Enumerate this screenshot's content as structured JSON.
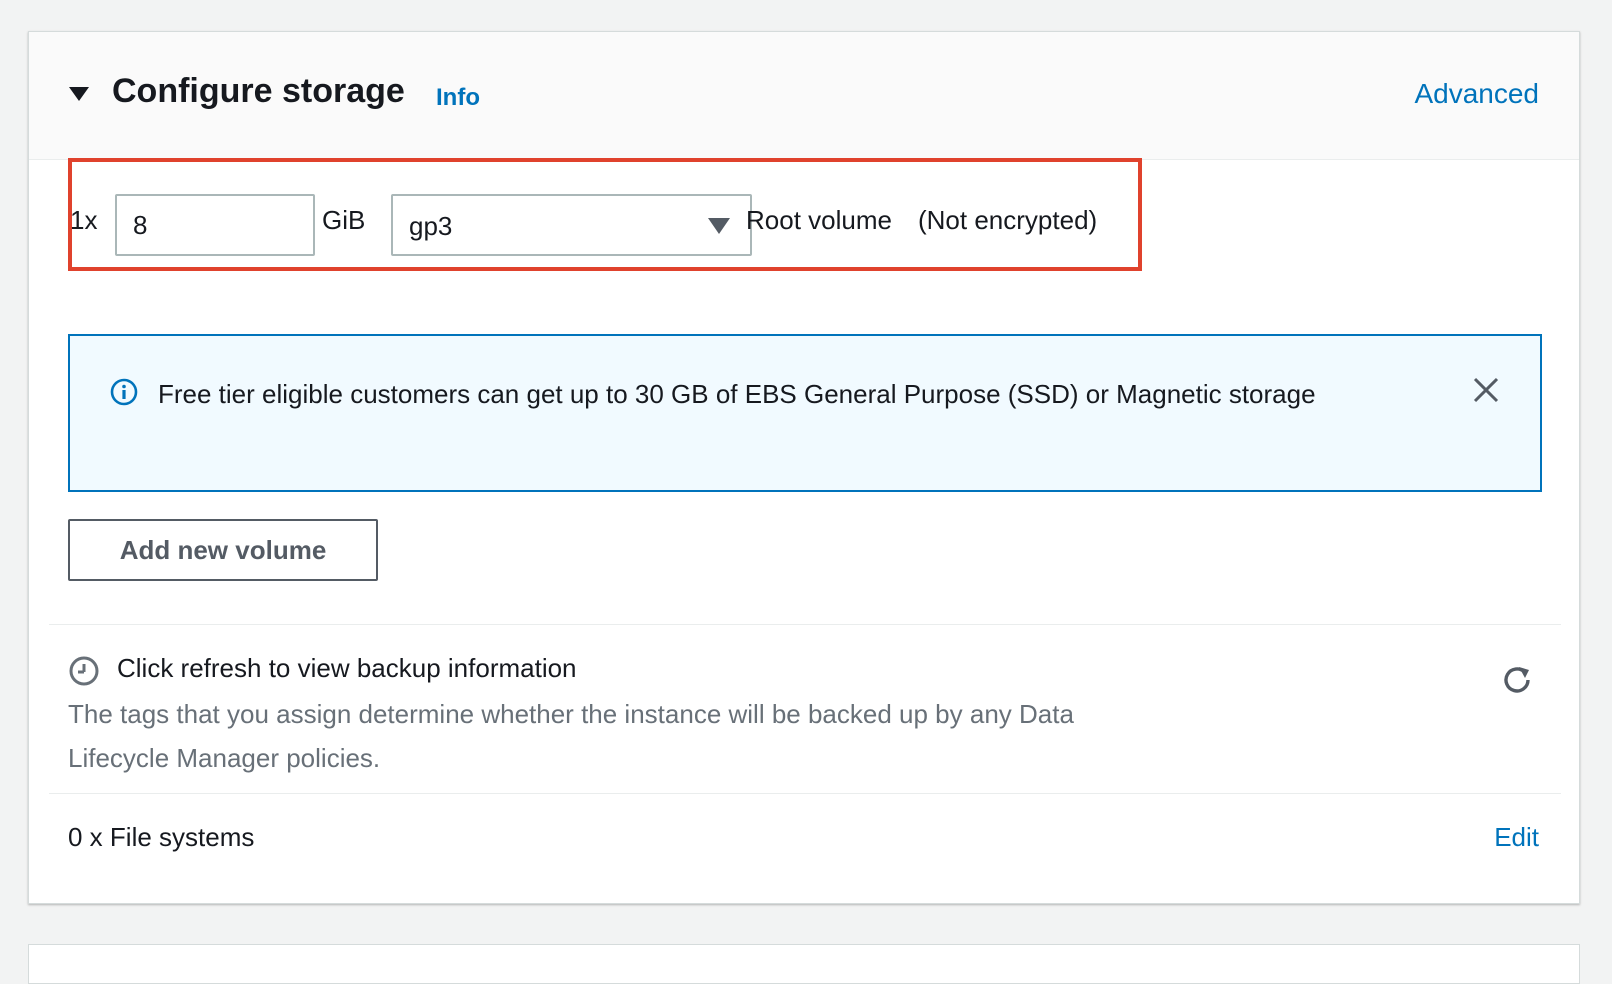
{
  "section": {
    "title": "Configure storage",
    "info_link": "Info",
    "advanced_link": "Advanced"
  },
  "volume_row": {
    "count_label": "1x",
    "size_value": "8",
    "size_unit": "GiB",
    "volume_type": "gp3",
    "volume_label": "Root volume",
    "encryption_status": "(Not encrypted)"
  },
  "free_tier_alert": {
    "icon": "info-circle-icon",
    "message": "Free tier eligible customers can get up to 30 GB of EBS General Purpose (SSD) or Magnetic storage",
    "close_icon": "close-icon"
  },
  "add_volume_button": "Add new volume",
  "backup": {
    "icon": "clock-icon",
    "title": "Click refresh to view backup information",
    "description": "The tags that you assign determine whether the instance will be backed up by any Data Lifecycle Manager policies.",
    "refresh_icon": "refresh-icon"
  },
  "file_systems": {
    "summary": "0 x File systems",
    "edit_link": "Edit"
  },
  "colors": {
    "link": "#0073bb",
    "highlight": "#e0422d",
    "alert_bg": "#f1faff",
    "alert_border": "#0073bb"
  }
}
